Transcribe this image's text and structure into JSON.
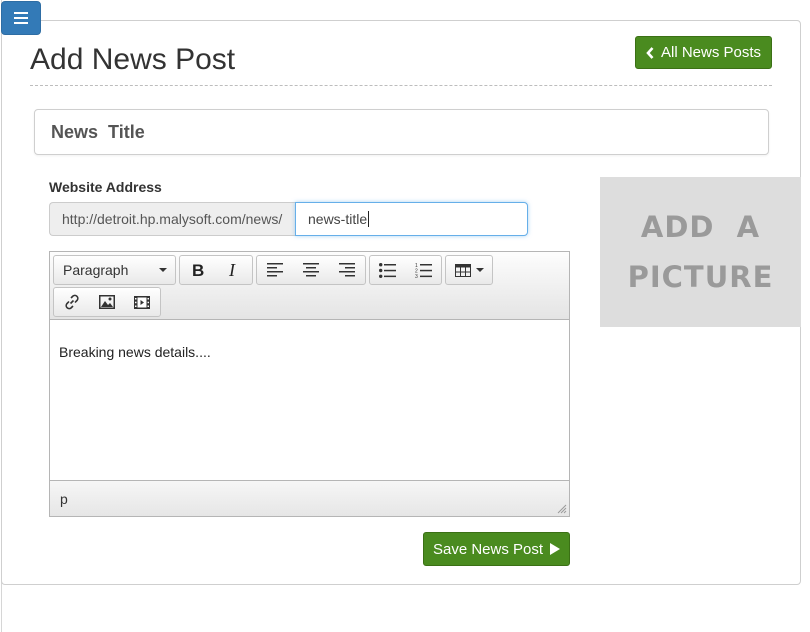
{
  "page": {
    "title": "Add News Post"
  },
  "header": {
    "all_posts_label": "All News Posts"
  },
  "news_title": "News  Title",
  "website_address": {
    "label": "Website Address",
    "prefix": "http://detroit.hp.malysoft.com/news/",
    "slug_value": "news-title"
  },
  "picture": {
    "line1": "ADD  A",
    "line2": "PICTURE"
  },
  "editor": {
    "format_selected": "Paragraph",
    "toolbar_icons": [
      "bold-icon",
      "italic-icon",
      "align-left-icon",
      "align-center-icon",
      "align-right-icon",
      "bullet-list-icon",
      "numbered-list-icon",
      "table-icon",
      "link-icon",
      "image-icon",
      "video-icon"
    ],
    "content": "Breaking news details....",
    "status_path": "p"
  },
  "save_label": "Save News Post",
  "colors": {
    "primary_blue": "#337ab7",
    "success_green": "#4a8b1f",
    "picture_bg": "#dddddd",
    "picture_text": "#9a9a9a"
  }
}
